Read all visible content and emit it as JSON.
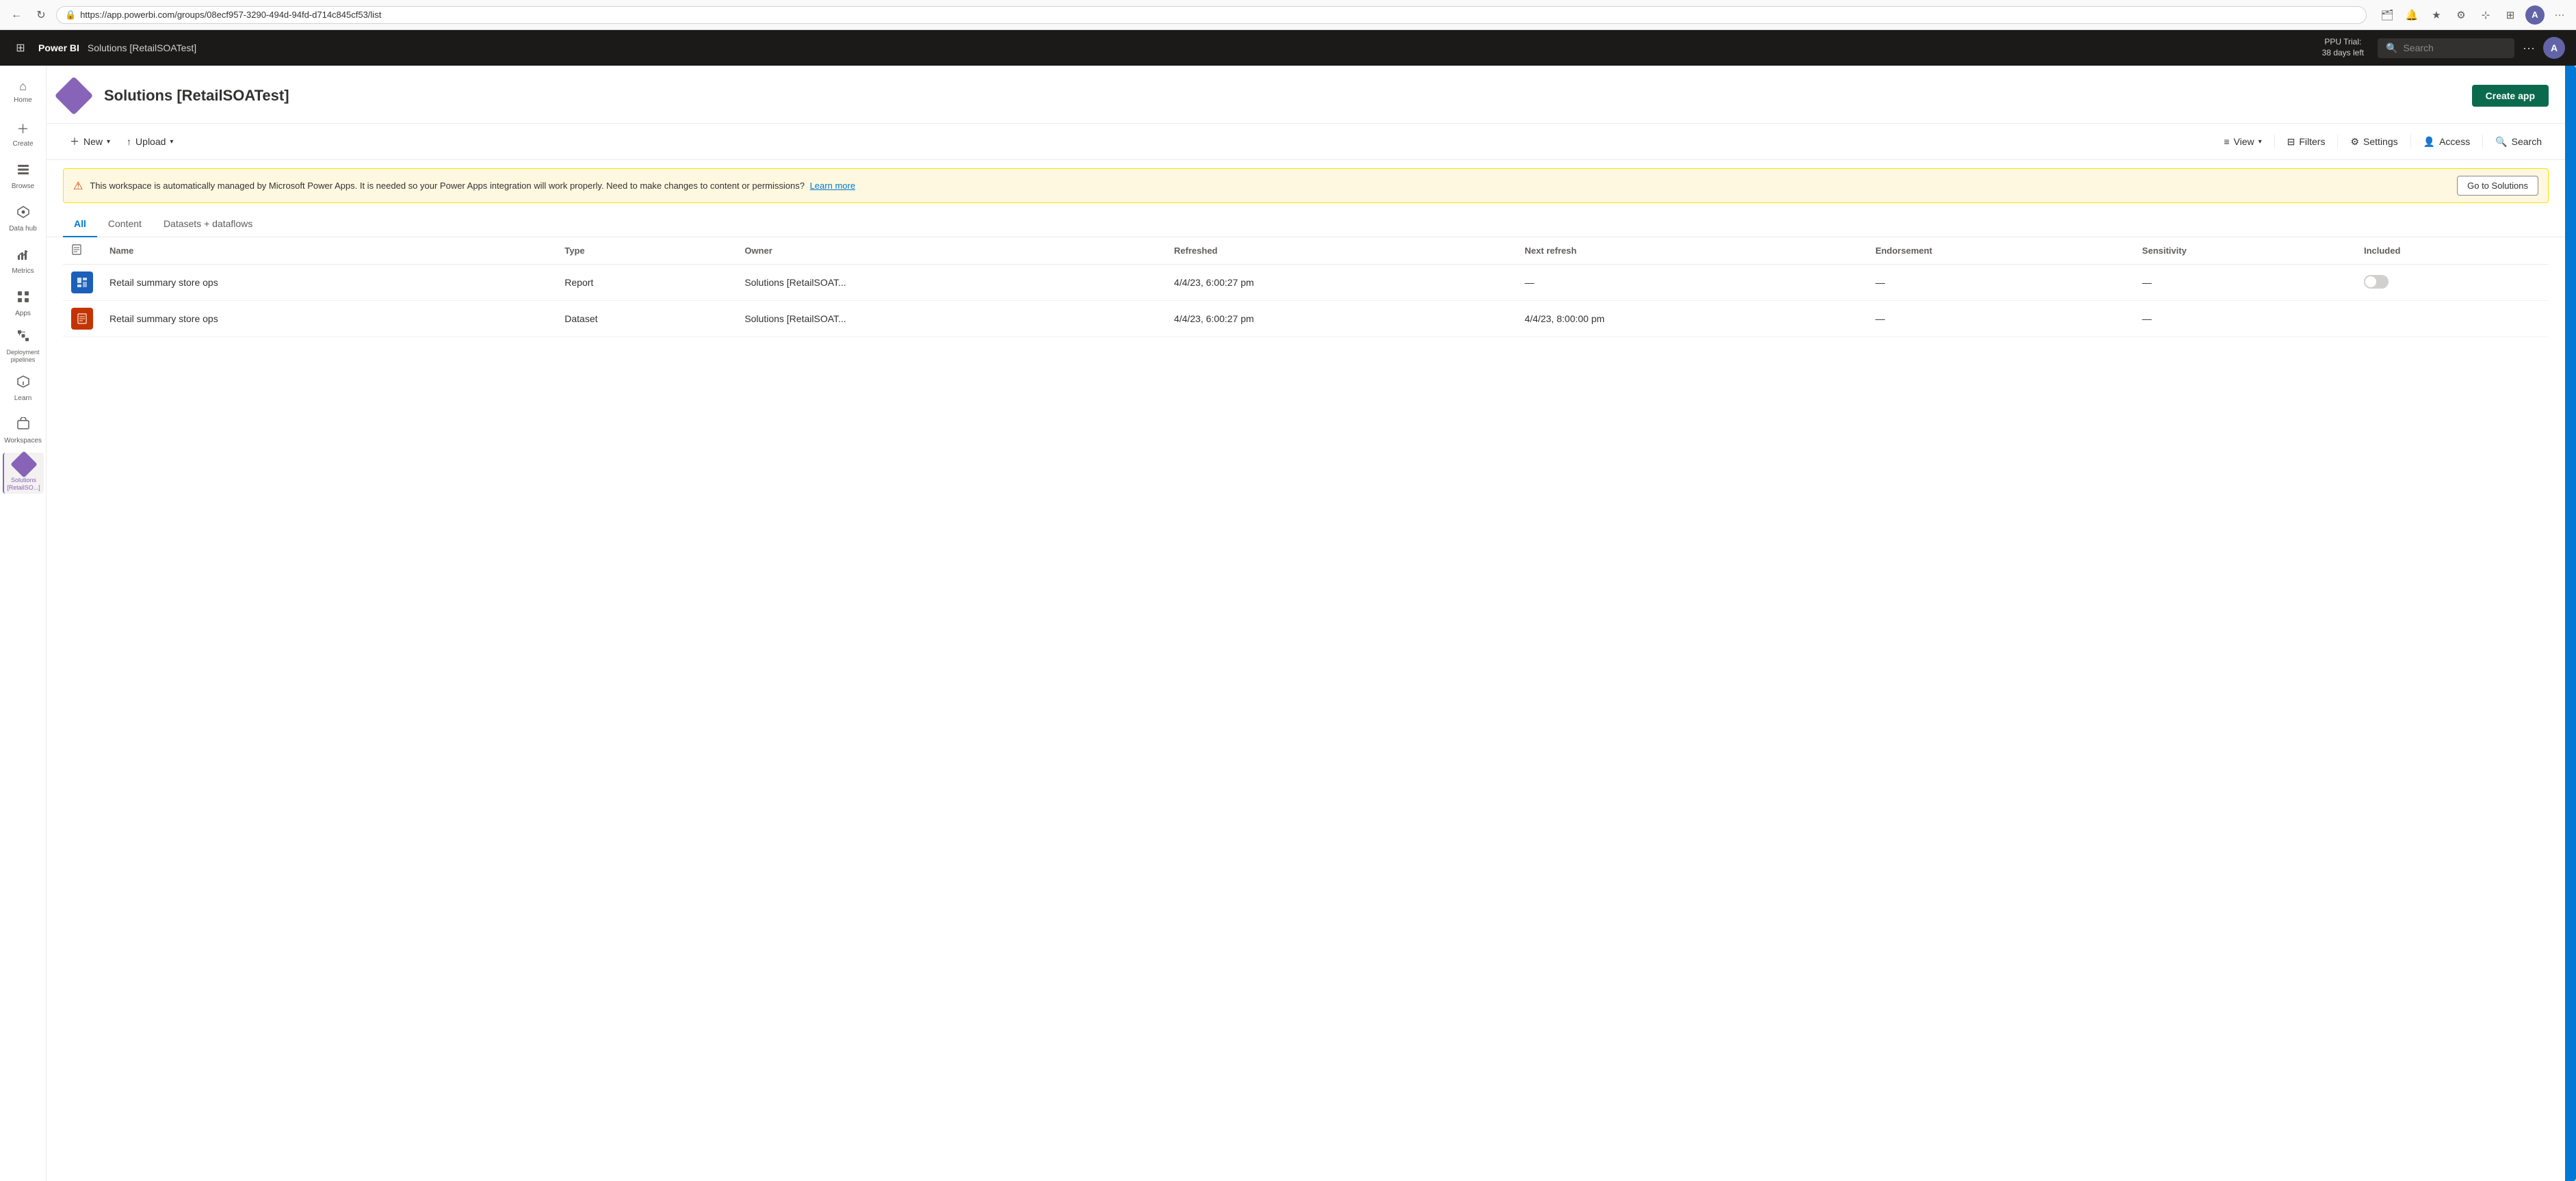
{
  "browser": {
    "url": "https://app.powerbi.com/groups/08ecf957-3290-494d-94fd-d714c845cf53/list",
    "back_title": "Back",
    "reload_title": "Reload"
  },
  "topnav": {
    "app_name": "Power BI",
    "workspace_name": "Solutions [RetailSOATest]",
    "ppu_line1": "PPU Trial:",
    "ppu_line2": "38 days left",
    "search_placeholder": "Search",
    "more_label": "···",
    "user_initial": "A"
  },
  "sidebar": {
    "items": [
      {
        "id": "home",
        "label": "Home",
        "icon": "⌂"
      },
      {
        "id": "create",
        "label": "Create",
        "icon": "+"
      },
      {
        "id": "browse",
        "label": "Browse",
        "icon": "⊞"
      },
      {
        "id": "datahub",
        "label": "Data hub",
        "icon": "⊘"
      },
      {
        "id": "metrics",
        "label": "Metrics",
        "icon": "◫"
      },
      {
        "id": "apps",
        "label": "Apps",
        "icon": "⊟"
      },
      {
        "id": "deployment",
        "label": "Deployment pipelines",
        "icon": "⊠"
      },
      {
        "id": "learn",
        "label": "Learn",
        "icon": "📖"
      },
      {
        "id": "workspaces",
        "label": "Workspaces",
        "icon": "⊡"
      },
      {
        "id": "solutions",
        "label": "Solutions [RetailSO...]",
        "icon": "◆",
        "active": true
      }
    ]
  },
  "page": {
    "title": "Solutions [RetailSOATest]",
    "create_app_label": "Create app"
  },
  "toolbar": {
    "new_label": "New",
    "upload_label": "Upload",
    "view_label": "View",
    "filters_label": "Filters",
    "settings_label": "Settings",
    "access_label": "Access",
    "search_label": "Search"
  },
  "warning": {
    "text": "This workspace is automatically managed by Microsoft Power Apps. It is needed so your Power Apps integration will work properly. Need to make changes to content or permissions?",
    "link_text": "Learn more",
    "button_label": "Go to Solutions"
  },
  "tabs": [
    {
      "id": "all",
      "label": "All",
      "active": true
    },
    {
      "id": "content",
      "label": "Content"
    },
    {
      "id": "datasets",
      "label": "Datasets + dataflows"
    }
  ],
  "table": {
    "columns": [
      {
        "id": "name",
        "label": "Name"
      },
      {
        "id": "type",
        "label": "Type"
      },
      {
        "id": "owner",
        "label": "Owner"
      },
      {
        "id": "refreshed",
        "label": "Refreshed"
      },
      {
        "id": "next_refresh",
        "label": "Next refresh"
      },
      {
        "id": "endorsement",
        "label": "Endorsement"
      },
      {
        "id": "sensitivity",
        "label": "Sensitivity"
      },
      {
        "id": "included",
        "label": "Included"
      }
    ],
    "rows": [
      {
        "id": "row1",
        "icon_type": "report",
        "name": "Retail summary store ops",
        "type": "Report",
        "owner": "Solutions [RetailSOAT...",
        "refreshed": "4/4/23, 6:00:27 pm",
        "next_refresh": "—",
        "endorsement": "—",
        "sensitivity": "—",
        "included": "toggle_off"
      },
      {
        "id": "row2",
        "icon_type": "dataset",
        "name": "Retail summary store ops",
        "type": "Dataset",
        "owner": "Solutions [RetailSOAT...",
        "refreshed": "4/4/23, 6:00:27 pm",
        "next_refresh": "4/4/23, 8:00:00 pm",
        "endorsement": "—",
        "sensitivity": "—",
        "included": ""
      }
    ]
  }
}
